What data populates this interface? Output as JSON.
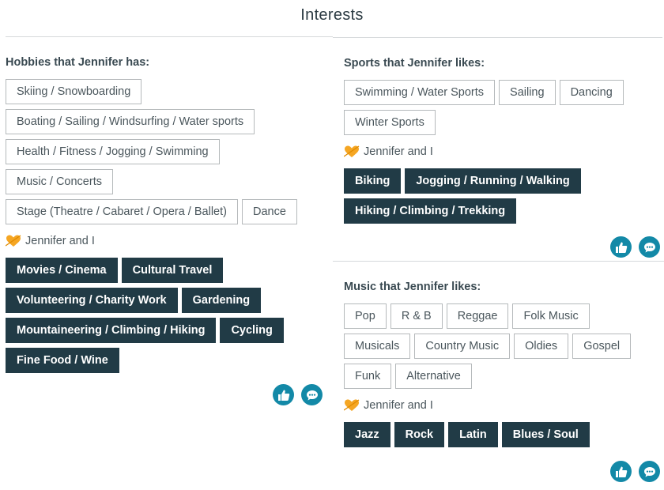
{
  "page": {
    "title": "Interests"
  },
  "hobbies": {
    "label": "Hobbies that Jennifer has:",
    "tags": [
      "Skiing / Snowboarding",
      "Boating / Sailing / Windsurfing / Water sports",
      "Health / Fitness / Jogging / Swimming",
      "Music / Concerts",
      "Stage (Theatre / Cabaret / Opera / Ballet)",
      "Dance"
    ],
    "shared_label": "Jennifer and I",
    "shared_tags": [
      "Movies / Cinema",
      "Cultural Travel",
      "Volunteering / Charity Work",
      "Gardening",
      "Mountaineering / Climbing / Hiking",
      "Cycling",
      "Fine Food / Wine"
    ]
  },
  "sports": {
    "label": "Sports that Jennifer likes:",
    "tags": [
      "Swimming / Water Sports",
      "Sailing",
      "Dancing",
      "Winter Sports"
    ],
    "shared_label": "Jennifer and I",
    "shared_tags": [
      "Biking",
      "Jogging / Running / Walking",
      "Hiking / Climbing / Trekking"
    ]
  },
  "music": {
    "label": "Music that Jennifer likes:",
    "tags": [
      "Pop",
      "R & B",
      "Reggae",
      "Folk Music",
      "Musicals",
      "Country Music",
      "Oldies",
      "Gospel",
      "Funk",
      "Alternative"
    ],
    "shared_label": "Jennifer and I",
    "shared_tags": [
      "Jazz",
      "Rock",
      "Latin",
      "Blues / Soul"
    ]
  },
  "icons": {
    "heart": "heart-arrow-icon",
    "like": "thumbs-up-icon",
    "comment": "chat-bubble-icon"
  },
  "colors": {
    "dark_tag": "#213b46",
    "accent": "#1389a7",
    "heart": "#f5a623"
  }
}
